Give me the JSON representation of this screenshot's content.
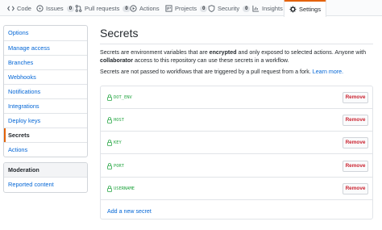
{
  "tabs": [
    {
      "label": "Code",
      "icon": "code-icon",
      "count": null,
      "selected": false
    },
    {
      "label": "Issues",
      "icon": "issue-icon",
      "count": "0",
      "selected": false
    },
    {
      "label": "Pull requests",
      "icon": "pull-request-icon",
      "count": "0",
      "selected": false
    },
    {
      "label": "Actions",
      "icon": "play-icon",
      "count": null,
      "selected": false
    },
    {
      "label": "Projects",
      "icon": "project-icon",
      "count": "0",
      "selected": false
    },
    {
      "label": "Security",
      "icon": "shield-icon",
      "count": "0",
      "selected": false
    },
    {
      "label": "Insights",
      "icon": "graph-icon",
      "count": null,
      "selected": false
    },
    {
      "label": "Settings",
      "icon": "gear-icon",
      "count": null,
      "selected": true
    }
  ],
  "sidebar": {
    "items": [
      {
        "label": "Options",
        "selected": false
      },
      {
        "label": "Manage access",
        "selected": false
      },
      {
        "label": "Branches",
        "selected": false
      },
      {
        "label": "Webhooks",
        "selected": false
      },
      {
        "label": "Notifications",
        "selected": false
      },
      {
        "label": "Integrations",
        "selected": false
      },
      {
        "label": "Deploy keys",
        "selected": false
      },
      {
        "label": "Secrets",
        "selected": true
      },
      {
        "label": "Actions",
        "selected": false
      }
    ],
    "moderation": {
      "heading": "Moderation",
      "items": [
        {
          "label": "Reported content"
        }
      ]
    }
  },
  "main": {
    "title": "Secrets",
    "description": {
      "part1": "Secrets are environment variables that are ",
      "bold1": "encrypted",
      "part2": " and only exposed to selected actions. Anyone with ",
      "bold2": "collaborator",
      "part3": " access to this repository can use these secrets in a workflow."
    },
    "note": "Secrets are not passed to workflows that are triggered by a pull request from a fork.",
    "learn_more": "Learn more.",
    "secrets": [
      {
        "name": "DOT_ENV"
      },
      {
        "name": "HOST"
      },
      {
        "name": "KEY"
      },
      {
        "name": "PORT"
      },
      {
        "name": "USERNAME"
      }
    ],
    "remove_label": "Remove",
    "add_link": "Add a new secret"
  },
  "colors": {
    "accent": "#e36209",
    "link": "#0366d6",
    "secret_name": "#28a745",
    "danger": "#cb2431"
  }
}
